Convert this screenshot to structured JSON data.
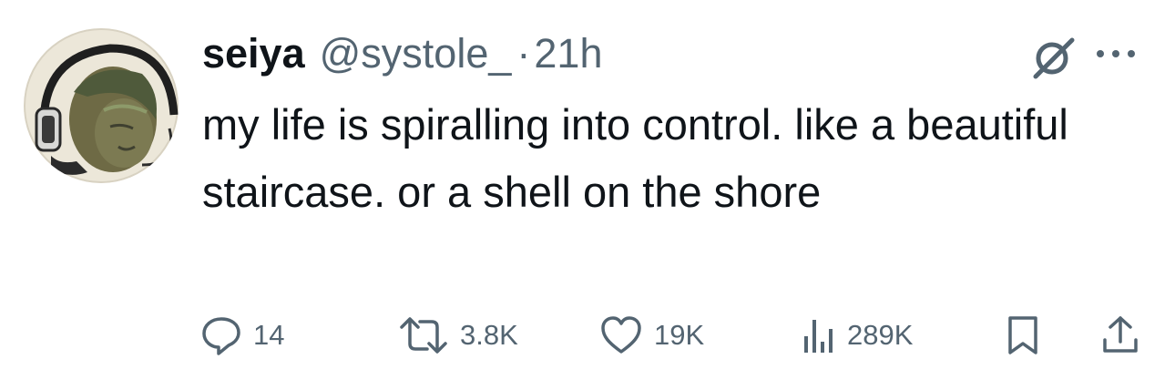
{
  "tweet": {
    "author_name": "seiya",
    "author_handle": "@systole_",
    "separator": "·",
    "time": "21h",
    "text": "my life is spiralling into control. like a beautiful staircase. or a shell on the shore"
  },
  "actions": {
    "replies": "14",
    "retweets": "3.8K",
    "likes": "19K",
    "views": "289K"
  },
  "icons": {
    "reply": "reply-icon",
    "retweet": "retweet-icon",
    "like": "heart-icon",
    "views": "views-icon",
    "bookmark": "bookmark-icon",
    "share": "share-icon",
    "grok": "grok-icon",
    "more": "more-icon"
  },
  "colors": {
    "text": "#0f1419",
    "secondary": "#536471",
    "background": "#ffffff"
  }
}
